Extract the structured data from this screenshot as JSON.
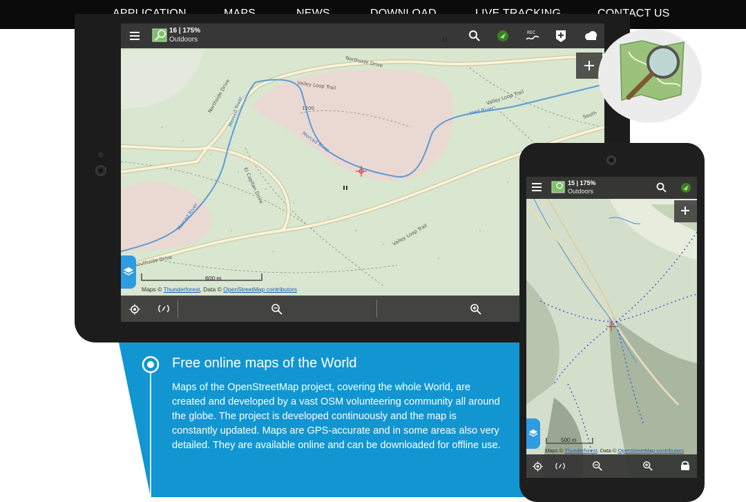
{
  "nav": {
    "items": [
      "APPLICATION",
      "MAPS",
      "NEWS",
      "DOWNLOAD",
      "LIVE TRACKING",
      "CONTACT US"
    ]
  },
  "feature": {
    "title": "Free online maps of the World",
    "text": "Maps of the OpenStreetMap project, covering the whole World, are created and developed by a vast OSM volunteering community all around the globe. The project is developed continuously and the map is constantly updated. Maps are GPS-accurate and in some areas also very detailed. They are available online and can be downloaded for offline use."
  },
  "tablet": {
    "zoom_info": "16 | 175%",
    "map_style": "Outdoors",
    "scale": "600 m",
    "credits_prefix": "Maps ©",
    "credits_link1": "Thunderforest",
    "credits_mid": ", Data ©",
    "credits_link2": "OpenStreetMap contributors",
    "map_labels": {
      "northside_drive": "Northside Drive",
      "merced_river_1": "Merced River",
      "merced_river_2": "Merced River",
      "merced_river_3": "rced River",
      "merced_river_4": "Merced River",
      "valley_loop_trail_1": "Valley Loop Trail",
      "valley_loop_trail_2": "Valley Loop Trail",
      "valley_loop_trail_3": "Valley Loop Trail",
      "el_capitan_drive": "El Capitan Drive",
      "southside_drive_1": "Southside Drive",
      "southside_drive_2": "South",
      "north_drive": "Northside Drive",
      "elev": "1200"
    }
  },
  "phone": {
    "zoom_info": "15 | 175%",
    "map_style": "Outdoors",
    "scale": "500 m",
    "credits_prefix": "Maps ©",
    "credits_link1": "Thunderforest",
    "credits_mid": ", Data ©",
    "credits_link2": "OpenStreetMap contributors"
  },
  "colors": {
    "nav_bg": "#0b0b0b",
    "feature_blue": "#1196d2",
    "map_green": "#d9e6d0",
    "map_pink": "#ead9d2",
    "river": "#5b9bd5",
    "road": "#f7f3d6",
    "layers_button": "#2f9be0"
  },
  "icons": {
    "menu": "menu-icon",
    "map_thumb": "map-thumbnail-icon",
    "search": "search-icon",
    "gps": "gps-icon",
    "track_rec": "track-record-icon",
    "add_point": "add-point-icon",
    "weather": "weather-icon",
    "plus": "zoom-plus-icon",
    "layers": "layers-icon",
    "target": "my-location-icon",
    "signal": "gps-signal-icon",
    "zoom_out": "zoom-out-icon",
    "zoom_in": "zoom-in-icon",
    "lock": "lock-icon",
    "logo": "osm-magnifier-logo"
  }
}
